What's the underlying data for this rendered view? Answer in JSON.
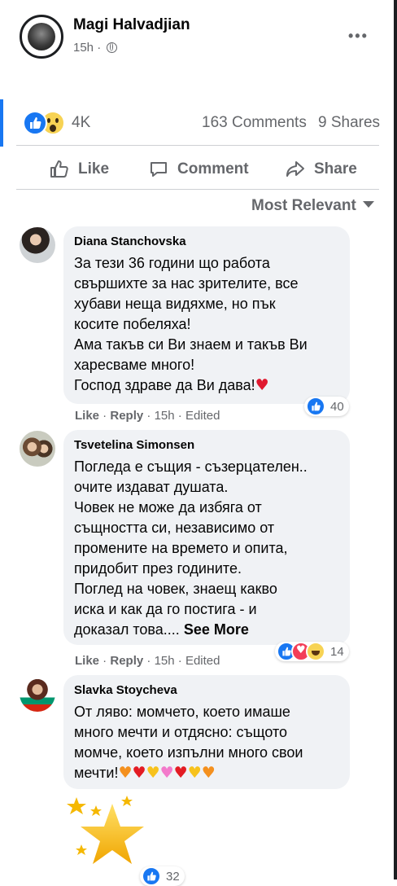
{
  "post": {
    "author": "Magi Halvadjian",
    "time": "15h",
    "separator": "·",
    "reaction_count": "4K",
    "comments": "163 Comments",
    "shares": "9 Shares"
  },
  "actions": {
    "like": "Like",
    "comment": "Comment",
    "share": "Share"
  },
  "sort_label": "Most Relevant",
  "comments": [
    {
      "name": "Diana Stanchovska",
      "text": "За тези 36 години що работа\nсвършихте за нас зрителите, все\nхубави неща видяхме, но пък\nкосите побеляха!\nАма такъв си Ви знаем и такъв Ви\nхаресваме много!\nГоспод здраве да Ви дава!",
      "emoji": "♥",
      "like": "Like",
      "reply": "Reply",
      "time": "15h",
      "edited": "Edited",
      "reaction_count": "40"
    },
    {
      "name": "Tsvetelina Simonsen",
      "text": "Погледа е същия - съзерцателен..\nочите издават душата.\nЧовек не може да избяга от\nсъщността си, независимо от\nпромените на времето и опита,\nпридобит през годините.\nПоглед на човек, знаещ какво\nиска и как да го постига - и\nдоказал това....",
      "see_more": "See More",
      "like": "Like",
      "reply": "Reply",
      "time": "15h",
      "edited": "Edited",
      "reaction_count": "14"
    },
    {
      "name": "Slavka Stoycheva",
      "text": "От ляво: момчето, което имаше\nмного мечти и отдясно: същото\nмомче, което изпълни много свои\nмечти!",
      "hearts": [
        "♥",
        "♥",
        "♥",
        "♥",
        "♥",
        "♥",
        "♥"
      ],
      "reaction_count": "32"
    }
  ],
  "colors": {
    "facebook_blue": "#1877f2",
    "secondary_text": "#65676b",
    "bubble_bg": "#f0f2f5"
  }
}
